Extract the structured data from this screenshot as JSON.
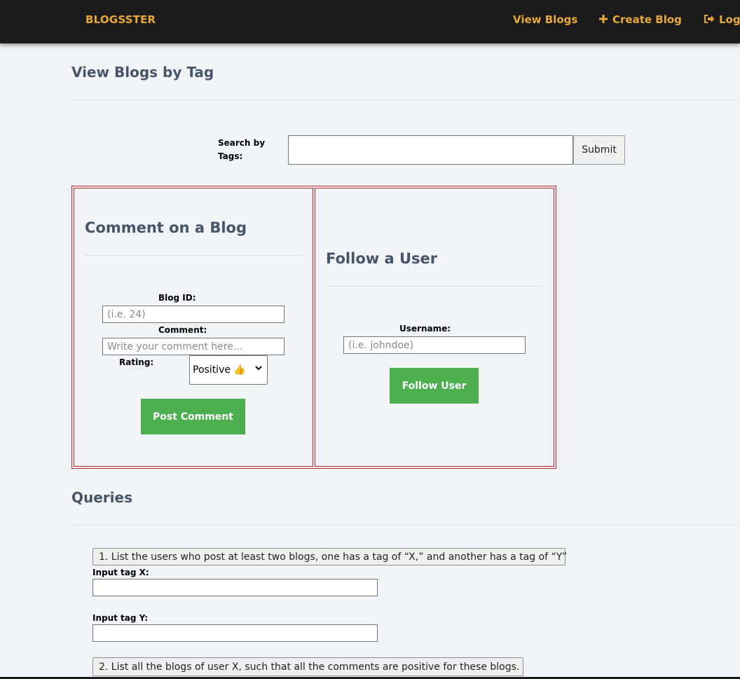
{
  "nav": {
    "brand": "BLOGSSTER",
    "view_blogs": "View Blogs",
    "create_blog": "Create Blog",
    "logout": "Log"
  },
  "view_tag": {
    "title": "View Blogs by Tag",
    "search_label_line1": "Search by",
    "search_label_line2": "Tags:",
    "search_value": "",
    "submit_label": "Submit"
  },
  "comment": {
    "title": "Comment on a Blog",
    "blog_id_label": "Blog ID:",
    "blog_id_placeholder": "(i.e. 24)",
    "comment_label": "Comment:",
    "comment_placeholder": "Write your comment here...",
    "rating_label": "Rating:",
    "rating_value": "Positive 👍",
    "post_button": "Post Comment"
  },
  "follow": {
    "title": "Follow a User",
    "username_label": "Username:",
    "username_placeholder": "(i.e. johndoe)",
    "follow_button": "Follow User"
  },
  "queries": {
    "title": "Queries",
    "q1_button": "1. List the users who post at least two blogs, one has a tag of “X,” and another has a tag of “Y”",
    "q1_tag_x_label": "Input tag X:",
    "q1_tag_y_label": "Input tag Y:",
    "q2_button": "2. List all the blogs of user X, such that all the comments are positive for these blogs."
  },
  "colors": {
    "nav_bg": "#1b1b1b",
    "accent": "#e8a93a",
    "heading": "#475569",
    "panel_border": "#b3262c",
    "green": "#4caf50"
  },
  "icons": {
    "create_blog": "plus-icon",
    "logout": "sign-out-icon",
    "select": "chevron-down-icon"
  }
}
